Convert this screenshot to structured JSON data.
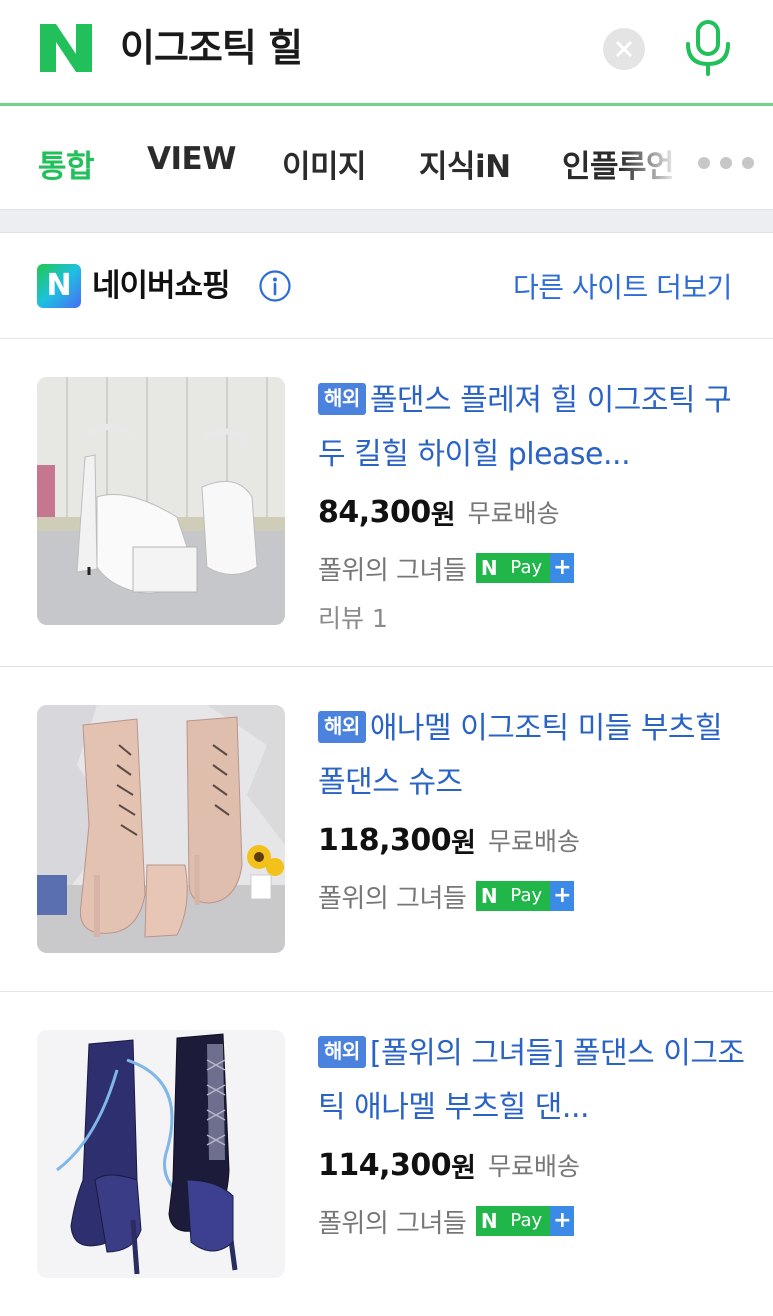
{
  "search": {
    "query": "이그조틱 힐"
  },
  "tabs": [
    {
      "label": "통합",
      "active": true
    },
    {
      "label": "VIEW",
      "active": false
    },
    {
      "label": "이미지",
      "active": false
    },
    {
      "label": "지식iN",
      "active": false
    },
    {
      "label": "인플루언",
      "active": false
    }
  ],
  "shopping": {
    "title": "네이버쇼핑",
    "more_sites": "다른 사이트 더보기"
  },
  "products": [
    {
      "badge": "해외",
      "title": "폴댄스 플레져 힐 이그조틱 구두 킬힐 하이힐 please...",
      "price": "84,300",
      "currency": "원",
      "shipping": "무료배송",
      "seller": "폴위의 그녀들",
      "review": "리뷰 1"
    },
    {
      "badge": "해외",
      "title": "애나멜 이그조틱 미들 부츠힐 폴댄스 슈즈",
      "price": "118,300",
      "currency": "원",
      "shipping": "무료배송",
      "seller": "폴위의 그녀들"
    },
    {
      "badge": "해외",
      "title": "[폴위의 그녀들] 폴댄스 이그조틱 애나멜 부츠힐 댄...",
      "price": "114,300",
      "currency": "원",
      "shipping": "무료배송",
      "seller": "폴위의 그녀들"
    }
  ],
  "npay": {
    "n": "N",
    "pay": "Pay",
    "plus": "+"
  },
  "colors": {
    "naver_green": "#21c05a",
    "link_blue": "#2a63c6",
    "badge_blue": "#4b82dd"
  }
}
